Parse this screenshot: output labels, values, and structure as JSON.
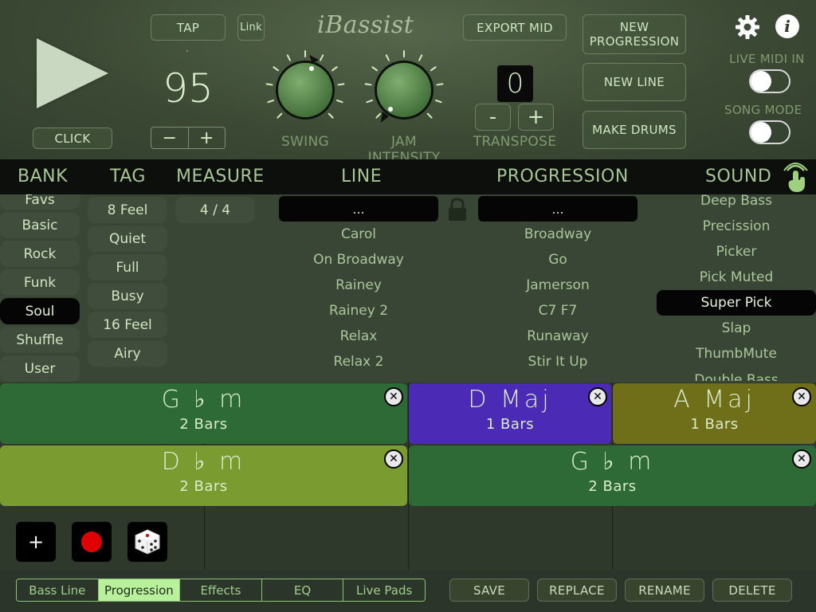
{
  "transport": {
    "tap_label": "TAP",
    "link_label": "Link",
    "click_label": "CLICK",
    "tempo": "95",
    "minus": "−",
    "plus": "+"
  },
  "logo": "iBassist",
  "knobs": {
    "swing_label": "SWING",
    "jam_label": "JAM INTENSITY"
  },
  "transpose": {
    "value": "0",
    "label": "TRANSPOSE",
    "minus": "-",
    "plus": "+"
  },
  "actions": {
    "export_mid": "EXPORT MID",
    "new_progression": "NEW PROGRESSION",
    "new_line": "NEW LINE",
    "make_drums": "MAKE DRUMS"
  },
  "settings": {
    "live_midi_in": "LIVE MIDI IN",
    "song_mode": "SONG MODE",
    "info_glyph": "i"
  },
  "headers": {
    "bank": "BANK",
    "tag": "TAG",
    "measure": "MEASURE",
    "line": "LINE",
    "progression": "PROGRESSION",
    "sound": "SOUND"
  },
  "bank": {
    "items": [
      "Favs",
      "Basic",
      "Rock",
      "Funk",
      "Soul",
      "Shuffle",
      "User"
    ],
    "selected": "Soul"
  },
  "tag": {
    "items": [
      "8 Feel",
      "Quiet",
      "Full",
      "Busy",
      "16 Feel",
      "Airy"
    ]
  },
  "measure": {
    "value": "4 / 4"
  },
  "line": {
    "search": "...",
    "items": [
      "Carol",
      "On Broadway",
      "Rainey",
      "Rainey 2",
      "Relax",
      "Relax 2"
    ]
  },
  "progression": {
    "search": "...",
    "items": [
      "Broadway",
      "Go",
      "Jamerson",
      "C7 F7",
      "Runaway",
      "Stir It Up"
    ]
  },
  "sound": {
    "items": [
      "Deep Bass",
      "Precission",
      "Picker",
      "Pick Muted",
      "Super Pick",
      "Slap",
      "ThumbMute",
      "Double Bass"
    ],
    "selected": "Super Pick"
  },
  "chords": [
    {
      "name": "G ♭ m",
      "bars": "2 Bars",
      "color": "#2e6a36"
    },
    {
      "name": "D Maj",
      "bars": "1 Bars",
      "color": "#4b2ab5"
    },
    {
      "name": "A Maj",
      "bars": "1 Bars",
      "color": "#6f6e19"
    },
    {
      "name": "D ♭ m",
      "bars": "2 Bars",
      "color": "#7a9b2f"
    },
    {
      "name": "G ♭ m",
      "bars": "2 Bars",
      "color": "#2e6a36"
    }
  ],
  "tools": {
    "add": "+"
  },
  "tabs": [
    "Bass Line",
    "Progression",
    "Effects",
    "EQ",
    "Live Pads"
  ],
  "active_tab": "Progression",
  "footer": {
    "save": "SAVE",
    "replace": "REPLACE",
    "rename": "RENAME",
    "delete": "DELETE"
  }
}
